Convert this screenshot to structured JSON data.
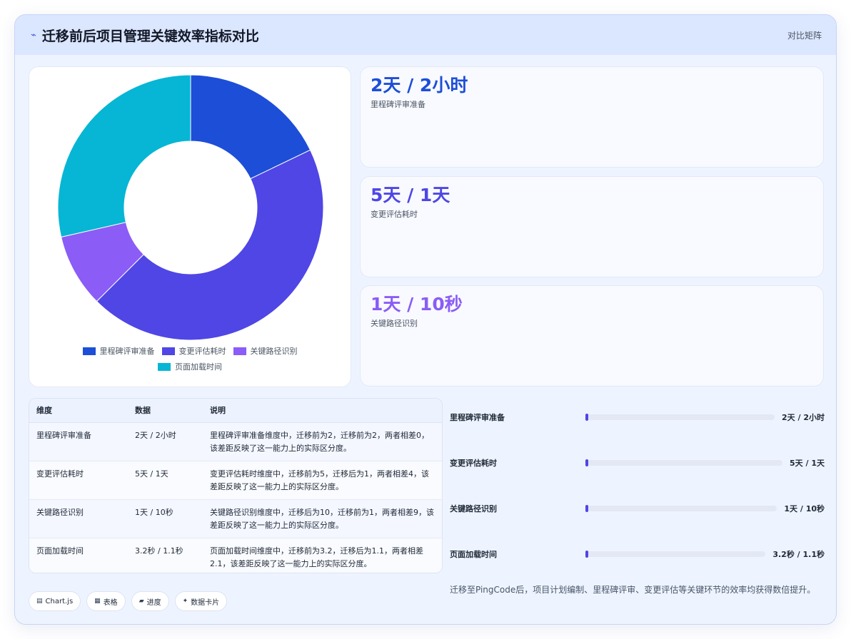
{
  "header": {
    "title": "迁移前后项目管理关键效率指标对比",
    "tag": "对比矩阵",
    "icon": "bolt-icon"
  },
  "chart_data": {
    "type": "pie",
    "categories": [
      "里程碑评审准备",
      "变更评估耗时",
      "关键路径识别",
      "页面加载时间"
    ],
    "values": [
      2,
      5,
      1,
      3.2
    ],
    "colors": [
      "#1d4ed8",
      "#4f46e5",
      "#8b5cf6",
      "#06b6d4"
    ],
    "legend_position": "bottom"
  },
  "kpis": [
    {
      "value": "2天 / 2小时",
      "label": "里程碑评审准备",
      "color": "#1d4ed8"
    },
    {
      "value": "5天 / 1天",
      "label": "变更评估耗时",
      "color": "#4f46e5"
    },
    {
      "value": "1天 / 10秒",
      "label": "关键路径识别",
      "color": "#8b5cf6"
    }
  ],
  "table": {
    "headers": [
      "维度",
      "数据",
      "说明"
    ],
    "rows": [
      {
        "dim": "里程碑评审准备",
        "data": "2天 / 2小时",
        "desc": "里程碑评审准备维度中，迁移前为2，迁移前为2，两者相差0，该差距反映了这一能力上的实际区分度。"
      },
      {
        "dim": "变更评估耗时",
        "data": "5天 / 1天",
        "desc": "变更评估耗时维度中，迁移前为5，迁移后为1，两者相差4，该差距反映了这一能力上的实际区分度。"
      },
      {
        "dim": "关键路径识别",
        "data": "1天 / 10秒",
        "desc": "关键路径识别维度中，迁移后为10，迁移前为1，两者相差9，该差距反映了这一能力上的实际区分度。"
      },
      {
        "dim": "页面加载时间",
        "data": "3.2秒 / 1.1秒",
        "desc": "页面加载时间维度中，迁移前为3.2，迁移后为1.1，两者相差2.1，该差距反映了这一能力上的实际区分度。"
      }
    ]
  },
  "progress": [
    {
      "label": "里程碑评审准备",
      "value": "2天 / 2小时",
      "fill": 0.01
    },
    {
      "label": "变更评估耗时",
      "value": "5天 / 1天",
      "fill": 0.01
    },
    {
      "label": "关键路径识别",
      "value": "1天 / 10秒",
      "fill": 0.01
    },
    {
      "label": "页面加载时间",
      "value": "3.2秒 / 1.1秒",
      "fill": 0.01
    }
  ],
  "chips": [
    {
      "icon": "chart-icon",
      "label": "Chart.js"
    },
    {
      "icon": "table-icon",
      "label": "表格"
    },
    {
      "icon": "progress-icon",
      "label": "进度"
    },
    {
      "icon": "sparkle-icon",
      "label": "数据卡片"
    }
  ],
  "summary": "迁移至PingCode后，项目计划编制、里程碑评审、变更评估等关键环节的效率均获得数倍提升。"
}
